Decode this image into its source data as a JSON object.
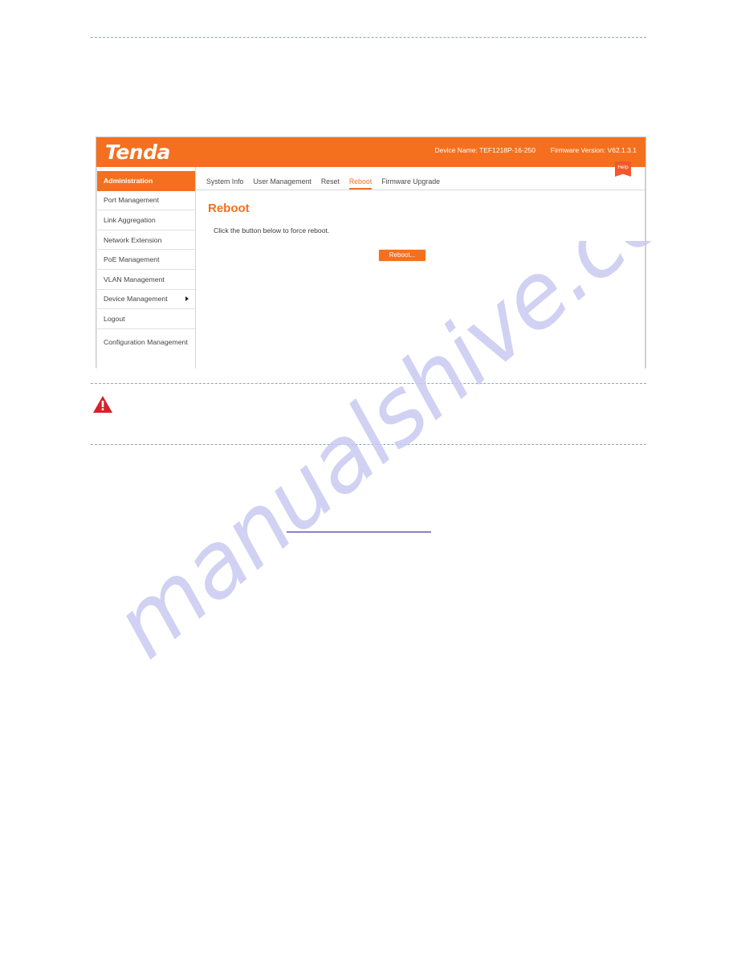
{
  "document": {
    "watermark_text": "manualshive.com",
    "warning_icon": "warning-triangle-icon"
  },
  "web_ui": {
    "header": {
      "logo_text": "Tenda",
      "device_name": "Device Name: TEF1218P-16-250",
      "firmware_version": "Firmware Version: V62.1.3.1"
    },
    "sidebar": {
      "items": [
        {
          "label": "Administration",
          "active": true,
          "has_submenu": false
        },
        {
          "label": "Port Management",
          "active": false,
          "has_submenu": false
        },
        {
          "label": "Link Aggregation",
          "active": false,
          "has_submenu": false
        },
        {
          "label": "Network Extension",
          "active": false,
          "has_submenu": false
        },
        {
          "label": "PoE Management",
          "active": false,
          "has_submenu": false
        },
        {
          "label": "VLAN Management",
          "active": false,
          "has_submenu": false
        },
        {
          "label": "Device Management",
          "active": false,
          "has_submenu": true
        },
        {
          "label": "Logout",
          "active": false,
          "has_submenu": false
        },
        {
          "label": "Configuration Management",
          "active": false,
          "has_submenu": false
        }
      ]
    },
    "tabs": [
      {
        "label": "System Info",
        "active": false
      },
      {
        "label": "User Management",
        "active": false
      },
      {
        "label": "Reset",
        "active": false
      },
      {
        "label": "Reboot",
        "active": true
      },
      {
        "label": "Firmware Upgrade",
        "active": false
      }
    ],
    "help_label": "Help",
    "panel": {
      "title": "Reboot",
      "description": "Click the button below to force reboot.",
      "button_label": "Reboot..."
    },
    "colors": {
      "accent_orange": "#f4701f",
      "help_orange": "#f4572b",
      "warning_red": "#d8202a",
      "watermark": "#c9c9f2",
      "rule_blue": "#8fa6bd",
      "link_underline": "#1a1a8c"
    }
  }
}
